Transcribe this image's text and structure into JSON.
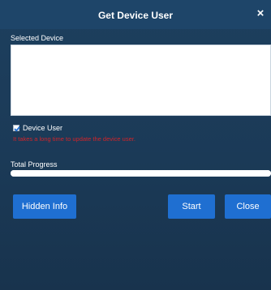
{
  "dialog": {
    "title": "Get Device User",
    "close_glyph": "×"
  },
  "selected_device": {
    "label": "Selected Device",
    "value": ""
  },
  "device_user": {
    "label": "Device User",
    "checked": true,
    "warning": "It takes a long time to update the device user."
  },
  "progress": {
    "label": "Total Progress",
    "fraction": 1.0
  },
  "buttons": {
    "hidden_info": "Hidden Info",
    "start": "Start",
    "close": "Close"
  },
  "colors": {
    "accent": "#1f6fd1",
    "warning": "#d1242a"
  }
}
